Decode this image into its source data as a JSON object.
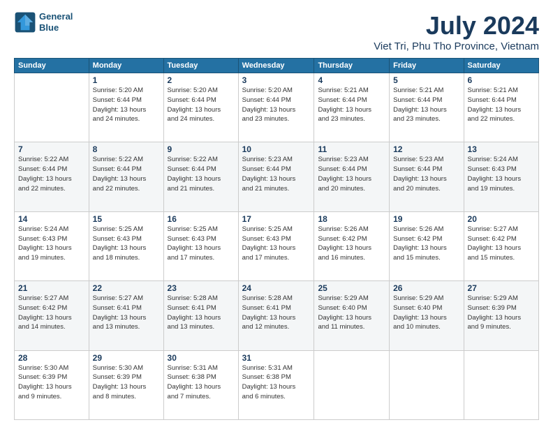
{
  "header": {
    "logo_line1": "General",
    "logo_line2": "Blue",
    "month": "July 2024",
    "location": "Viet Tri, Phu Tho Province, Vietnam"
  },
  "days_of_week": [
    "Sunday",
    "Monday",
    "Tuesday",
    "Wednesday",
    "Thursday",
    "Friday",
    "Saturday"
  ],
  "weeks": [
    [
      {
        "num": "",
        "info": ""
      },
      {
        "num": "1",
        "info": "Sunrise: 5:20 AM\nSunset: 6:44 PM\nDaylight: 13 hours\nand 24 minutes."
      },
      {
        "num": "2",
        "info": "Sunrise: 5:20 AM\nSunset: 6:44 PM\nDaylight: 13 hours\nand 24 minutes."
      },
      {
        "num": "3",
        "info": "Sunrise: 5:20 AM\nSunset: 6:44 PM\nDaylight: 13 hours\nand 23 minutes."
      },
      {
        "num": "4",
        "info": "Sunrise: 5:21 AM\nSunset: 6:44 PM\nDaylight: 13 hours\nand 23 minutes."
      },
      {
        "num": "5",
        "info": "Sunrise: 5:21 AM\nSunset: 6:44 PM\nDaylight: 13 hours\nand 23 minutes."
      },
      {
        "num": "6",
        "info": "Sunrise: 5:21 AM\nSunset: 6:44 PM\nDaylight: 13 hours\nand 22 minutes."
      }
    ],
    [
      {
        "num": "7",
        "info": "Sunrise: 5:22 AM\nSunset: 6:44 PM\nDaylight: 13 hours\nand 22 minutes."
      },
      {
        "num": "8",
        "info": "Sunrise: 5:22 AM\nSunset: 6:44 PM\nDaylight: 13 hours\nand 22 minutes."
      },
      {
        "num": "9",
        "info": "Sunrise: 5:22 AM\nSunset: 6:44 PM\nDaylight: 13 hours\nand 21 minutes."
      },
      {
        "num": "10",
        "info": "Sunrise: 5:23 AM\nSunset: 6:44 PM\nDaylight: 13 hours\nand 21 minutes."
      },
      {
        "num": "11",
        "info": "Sunrise: 5:23 AM\nSunset: 6:44 PM\nDaylight: 13 hours\nand 20 minutes."
      },
      {
        "num": "12",
        "info": "Sunrise: 5:23 AM\nSunset: 6:44 PM\nDaylight: 13 hours\nand 20 minutes."
      },
      {
        "num": "13",
        "info": "Sunrise: 5:24 AM\nSunset: 6:43 PM\nDaylight: 13 hours\nand 19 minutes."
      }
    ],
    [
      {
        "num": "14",
        "info": "Sunrise: 5:24 AM\nSunset: 6:43 PM\nDaylight: 13 hours\nand 19 minutes."
      },
      {
        "num": "15",
        "info": "Sunrise: 5:25 AM\nSunset: 6:43 PM\nDaylight: 13 hours\nand 18 minutes."
      },
      {
        "num": "16",
        "info": "Sunrise: 5:25 AM\nSunset: 6:43 PM\nDaylight: 13 hours\nand 17 minutes."
      },
      {
        "num": "17",
        "info": "Sunrise: 5:25 AM\nSunset: 6:43 PM\nDaylight: 13 hours\nand 17 minutes."
      },
      {
        "num": "18",
        "info": "Sunrise: 5:26 AM\nSunset: 6:42 PM\nDaylight: 13 hours\nand 16 minutes."
      },
      {
        "num": "19",
        "info": "Sunrise: 5:26 AM\nSunset: 6:42 PM\nDaylight: 13 hours\nand 15 minutes."
      },
      {
        "num": "20",
        "info": "Sunrise: 5:27 AM\nSunset: 6:42 PM\nDaylight: 13 hours\nand 15 minutes."
      }
    ],
    [
      {
        "num": "21",
        "info": "Sunrise: 5:27 AM\nSunset: 6:42 PM\nDaylight: 13 hours\nand 14 minutes."
      },
      {
        "num": "22",
        "info": "Sunrise: 5:27 AM\nSunset: 6:41 PM\nDaylight: 13 hours\nand 13 minutes."
      },
      {
        "num": "23",
        "info": "Sunrise: 5:28 AM\nSunset: 6:41 PM\nDaylight: 13 hours\nand 13 minutes."
      },
      {
        "num": "24",
        "info": "Sunrise: 5:28 AM\nSunset: 6:41 PM\nDaylight: 13 hours\nand 12 minutes."
      },
      {
        "num": "25",
        "info": "Sunrise: 5:29 AM\nSunset: 6:40 PM\nDaylight: 13 hours\nand 11 minutes."
      },
      {
        "num": "26",
        "info": "Sunrise: 5:29 AM\nSunset: 6:40 PM\nDaylight: 13 hours\nand 10 minutes."
      },
      {
        "num": "27",
        "info": "Sunrise: 5:29 AM\nSunset: 6:39 PM\nDaylight: 13 hours\nand 9 minutes."
      }
    ],
    [
      {
        "num": "28",
        "info": "Sunrise: 5:30 AM\nSunset: 6:39 PM\nDaylight: 13 hours\nand 9 minutes."
      },
      {
        "num": "29",
        "info": "Sunrise: 5:30 AM\nSunset: 6:39 PM\nDaylight: 13 hours\nand 8 minutes."
      },
      {
        "num": "30",
        "info": "Sunrise: 5:31 AM\nSunset: 6:38 PM\nDaylight: 13 hours\nand 7 minutes."
      },
      {
        "num": "31",
        "info": "Sunrise: 5:31 AM\nSunset: 6:38 PM\nDaylight: 13 hours\nand 6 minutes."
      },
      {
        "num": "",
        "info": ""
      },
      {
        "num": "",
        "info": ""
      },
      {
        "num": "",
        "info": ""
      }
    ]
  ]
}
